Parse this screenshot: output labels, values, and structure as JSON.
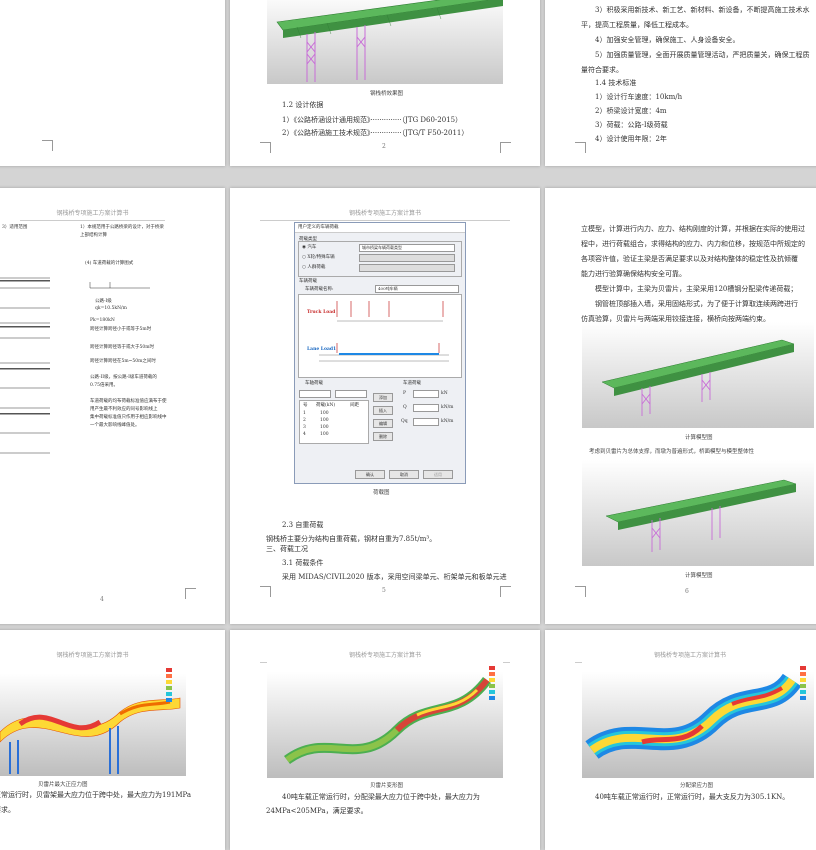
{
  "page_top_mid": {
    "fig_caption": "钢栈桥效果图",
    "section": "1.2 设计依据",
    "refs": [
      "1）《公路桥涵设计通用规范》··············（JTG D60-2015）",
      "2）《公路桥涵施工技术规范》··············（JTG/T F50-2011）"
    ],
    "page_number": "2"
  },
  "page_top_right": {
    "lines": [
      "3）积极采用新技术、新工艺、新材料、新设备，不断提高施工技术水",
      "平，提高工程质量，降低工程成本。",
      "4）加强安全管理，确保施工、人身设备安全。",
      "5）加强质量管理，全面开展质量管理活动，严把质量关，确保工程质",
      "量符合要求。",
      "1.4 技术标准",
      "1）设计行车速度：10km/h",
      "2）桥梁设计宽度：4m",
      "3）荷载：公路-I级荷载",
      "4）设计使用年限：2年"
    ],
    "page_number": "3"
  },
  "page_mid_left": {
    "header": "钢栈桥专项施工方案计算书",
    "lines": [
      "3）适用范围",
      "1）本规范用于公路桥梁的设计，对于桥梁",
      "上部结构计算",
      "(4) 车道荷载的计算图式",
      "公路-I级",
      "qk=10.5kN/m",
      "Pk=180kN",
      "跨径计算跨径小于或等于5m时",
      "跨径计算跨径等于或大于50m时",
      "跨径计算跨径在5m~50m之间时",
      "公路-II级，按公路-I级车道荷载的",
      "0.75倍采用。",
      "车道荷载的均布荷载标准值应满布于使",
      "用产生最不利效应的同号影响线上",
      "集中荷载标准值只作用于相应影响线中",
      "一个最大影响线峰值处。"
    ],
    "page_number": "4"
  },
  "page_mid_mid": {
    "header": "钢栈桥专项施工方案计算书",
    "dialog": {
      "title": "用户定义的车辆荷载",
      "group_load_type": "荷载类型",
      "radio_options": [
        "汽车",
        "X轮/特殊车辆",
        "人群荷载"
      ],
      "select_value": "城市桥梁车辆荷载类型",
      "group_vehicle": "车辆荷载",
      "vehicle_name_label": "车辆荷载名称:",
      "vehicle_name_value": "400吨车辆",
      "truck_label": "Truck Load",
      "lane_label": "Lane Load1",
      "axle_group": "车轴荷载",
      "axle_table_headers": [
        "号",
        "荷载(kN)",
        "间距"
      ],
      "axle_rows": [
        [
          "1",
          "100",
          ""
        ],
        [
          "2",
          "100",
          ""
        ],
        [
          "3",
          "100",
          ""
        ],
        [
          "4",
          "100",
          ""
        ]
      ],
      "lane_group": "车道荷载",
      "lane_fields": [
        "P",
        "Q",
        "Qq"
      ],
      "lane_units": [
        "kN",
        "kN/m",
        "kN/m"
      ],
      "side_buttons": [
        "添加",
        "插入",
        "编辑",
        "删除"
      ],
      "ok": "确认",
      "cancel": "取消",
      "apply": "适用"
    },
    "fig_caption": "荷载图",
    "lines": [
      "2.3 自重荷载",
      "钢栈桥主要分为结构自重荷载，钢材自重为7.85t/m³。",
      "三、荷载工况",
      "3.1 荷载条件",
      "采用 MIDAS/CIVIL2020 版本，采用空间梁单元、桁架单元和板单元进"
    ],
    "page_number": "5"
  },
  "page_mid_right": {
    "lines": [
      "立模型，计算进行内力、应力、结构刚度的计算，并根据在实际的使用过",
      "程中，进行荷载组合，求得结构的应力、内力和位移，按规范中所规定的",
      "各项容许值，验证主梁是否满足要求以及对结构整体的稳定性及抗倾覆",
      "能力进行验算确保结构安全可靠。",
      "模型计算中，主梁为贝雷片，主梁采用120槽钢分配梁传递荷载；",
      "钢管桩顶部插入墙，采用固结形式，为了便于计算取连续两跨进行",
      "仿真验算，贝雷片与两端采用铰接连接，横桥向按两端约束。"
    ],
    "fig1_caption": "计算模型图",
    "fig1_note": "考虑到贝雷片为总体支撑，而墩为普遍形式，桥面模型与模型整体性",
    "fig2_caption": "计算模型图",
    "page_number": "6"
  },
  "page_bot_left": {
    "header": "钢栈桥专项施工方案计算书",
    "fig_caption": "贝雷片最大正应力图",
    "lines": [
      "正常运行时，贝雷架最大应力位于跨中处，最大应力为191MPa",
      "要求。"
    ]
  },
  "page_bot_mid": {
    "header": "钢栈桥专项施工方案计算书",
    "fig_caption": "贝雷片变形图",
    "lines": [
      "40吨车载正常运行时，分配梁最大应力位于跨中处，最大应力为",
      "24MPa<205MPa，满足要求。"
    ]
  },
  "page_bot_right": {
    "header": "钢栈桥专项施工方案计算书",
    "fig_caption": "分配梁应力图",
    "lines": [
      "40吨车载正常运行时，正常运行时，最大支反力为305.1KN。"
    ]
  },
  "colors": {
    "background": "#d4d4d4",
    "deck_green": "#4caf50",
    "truss_magenta": "#c86dd7",
    "pier_blue": "#2a6fd6",
    "contour_red": "#e53935",
    "contour_yellow": "#fdd835"
  }
}
